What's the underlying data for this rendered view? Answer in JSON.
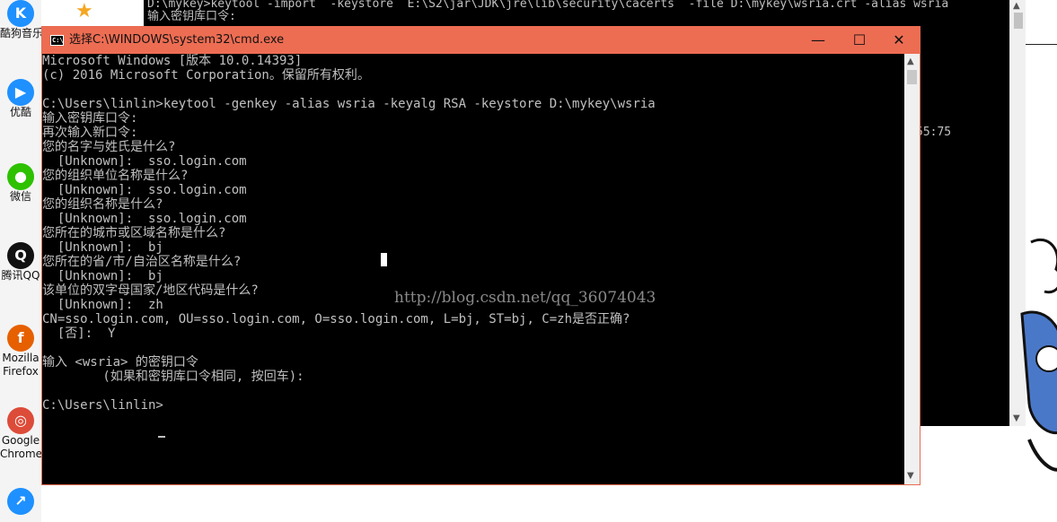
{
  "desktop": {
    "icons": [
      {
        "label": "酷狗音乐",
        "icon": "kugou-icon",
        "color": "#1e90ff",
        "glyph": "K"
      },
      {
        "label": "优酷",
        "icon": "youku-icon",
        "color": "#1e90ff",
        "glyph": "▶"
      },
      {
        "label": "微信",
        "icon": "wechat-icon",
        "color": "#2dc100",
        "glyph": "●"
      },
      {
        "label": "腾讯QQ",
        "icon": "qq-icon",
        "color": "#111111",
        "glyph": "Q"
      },
      {
        "label": "Mozilla",
        "icon": "firefox-icon",
        "color": "#e66000",
        "glyph": "f"
      },
      {
        "label": "Firefox",
        "icon": "",
        "color": "",
        "glyph": ""
      },
      {
        "label": "Google",
        "icon": "chrome-icon",
        "color": "#dd4b39",
        "glyph": "◎"
      },
      {
        "label": "Chrome",
        "icon": "",
        "color": "",
        "glyph": ""
      }
    ]
  },
  "background_window": {
    "lines": [
      "D:\\mykey>keytool -import  -keystore  E:\\S2\\jar\\JDK\\jre\\lib\\security\\cacerts  -file D:\\mykey\\wsria.crt -alias wsria",
      "输入密钥库口令:"
    ],
    "fragment": "55:75"
  },
  "window": {
    "title": "选择C:\\WINDOWS\\system32\\cmd.exe",
    "icon": "cmd-icon",
    "titlebar_color": "#ed6d53",
    "minimize_glyph": "—",
    "maximize_glyph": "☐",
    "close_glyph": "✕"
  },
  "console": {
    "lines": [
      "Microsoft Windows [版本 10.0.14393]",
      "(c) 2016 Microsoft Corporation。保留所有权利。",
      "",
      "C:\\Users\\linlin>keytool -genkey -alias wsria -keyalg RSA -keystore D:\\mykey\\wsria",
      "输入密钥库口令:",
      "再次输入新口令:",
      "您的名字与姓氏是什么?",
      "  [Unknown]:  sso.login.com",
      "您的组织单位名称是什么?",
      "  [Unknown]:  sso.login.com",
      "您的组织名称是什么?",
      "  [Unknown]:  sso.login.com",
      "您所在的城市或区域名称是什么?",
      "  [Unknown]:  bj",
      "您所在的省/市/自治区名称是什么?",
      "  [Unknown]:  bj",
      "该单位的双字母国家/地区代码是什么?",
      "  [Unknown]:  zh",
      "CN=sso.login.com, OU=sso.login.com, O=sso.login.com, L=bj, ST=bj, C=zh是否正确?",
      "  [否]:  Y",
      "",
      "输入 <wsria> 的密钥口令",
      "        (如果和密钥库口令相同, 按回车):",
      "",
      "C:\\Users\\linlin>"
    ],
    "watermark": "http://blog.csdn.net/qq_36074043"
  }
}
